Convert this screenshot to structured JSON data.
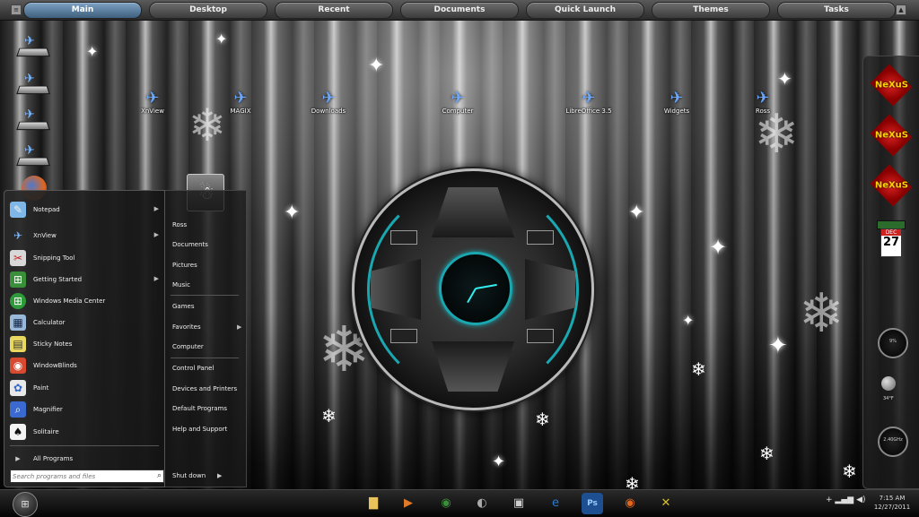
{
  "topbar": {
    "tabs": [
      {
        "label": "Main"
      },
      {
        "label": "Desktop"
      },
      {
        "label": "Recent"
      },
      {
        "label": "Documents"
      },
      {
        "label": "Quick Launch"
      },
      {
        "label": "Themes"
      },
      {
        "label": "Tasks"
      }
    ]
  },
  "desktop_icons": [
    {
      "label": "XnView"
    },
    {
      "label": "MAGIX"
    },
    {
      "label": "Downloads"
    },
    {
      "label": "Computer"
    },
    {
      "label": "LibreOffice 3.5"
    },
    {
      "label": "Widgets"
    },
    {
      "label": "Ross"
    }
  ],
  "start_menu": {
    "programs": [
      {
        "label": "Notepad",
        "icon": "notepad-icon",
        "submenu": true
      },
      {
        "label": "XnView",
        "icon": "xnview-icon",
        "submenu": true
      },
      {
        "label": "Snipping Tool",
        "icon": "scissors-icon",
        "submenu": false
      },
      {
        "label": "Getting Started",
        "icon": "windows-flag-icon",
        "submenu": true
      },
      {
        "label": "Windows Media Center",
        "icon": "media-center-icon",
        "submenu": false
      },
      {
        "label": "Calculator",
        "icon": "calculator-icon",
        "submenu": false
      },
      {
        "label": "Sticky Notes",
        "icon": "sticky-notes-icon",
        "submenu": false
      },
      {
        "label": "WindowBlinds",
        "icon": "windowblinds-icon",
        "submenu": false
      },
      {
        "label": "Paint",
        "icon": "paint-palette-icon",
        "submenu": false
      },
      {
        "label": "Magnifier",
        "icon": "magnifier-icon",
        "submenu": false
      },
      {
        "label": "Solitaire",
        "icon": "cards-icon",
        "submenu": false
      }
    ],
    "all_programs": "All Programs",
    "search_placeholder": "Search programs and files",
    "right_items": [
      {
        "label": "Ross"
      },
      {
        "label": "Documents"
      },
      {
        "label": "Pictures"
      },
      {
        "label": "Music"
      },
      {
        "label": "Games"
      },
      {
        "label": "Favorites",
        "submenu": true
      },
      {
        "label": "Computer"
      },
      {
        "label": "Control Panel"
      },
      {
        "label": "Devices and Printers"
      },
      {
        "label": "Default Programs"
      },
      {
        "label": "Help and Support"
      }
    ],
    "shutdown": "Shut down"
  },
  "sidebar": {
    "nexus_label": "NeXuS",
    "calendar": {
      "month": "DEC",
      "day": "27"
    },
    "gauges": [
      "9%",
      "2.40GHz"
    ],
    "temp": "34°F"
  },
  "taskbar": {
    "pinned": [
      {
        "icon": "folder-icon",
        "color": "#e8c25a"
      },
      {
        "icon": "media-player-icon",
        "color": "#e07a2a"
      },
      {
        "icon": "chrome-icon",
        "color": "#3a8f3a"
      },
      {
        "icon": "winamp-icon",
        "color": "#555555"
      },
      {
        "icon": "camera-icon",
        "color": "#444444"
      },
      {
        "icon": "ie-icon",
        "color": "#2a7ad0"
      },
      {
        "icon": "photoshop-icon",
        "color": "#1d4f91"
      },
      {
        "icon": "firefox-icon",
        "color": "#e0661e"
      },
      {
        "icon": "tools-icon",
        "color": "#d8c030"
      }
    ],
    "time": "7:15 AM",
    "date": "12/27/2011"
  }
}
